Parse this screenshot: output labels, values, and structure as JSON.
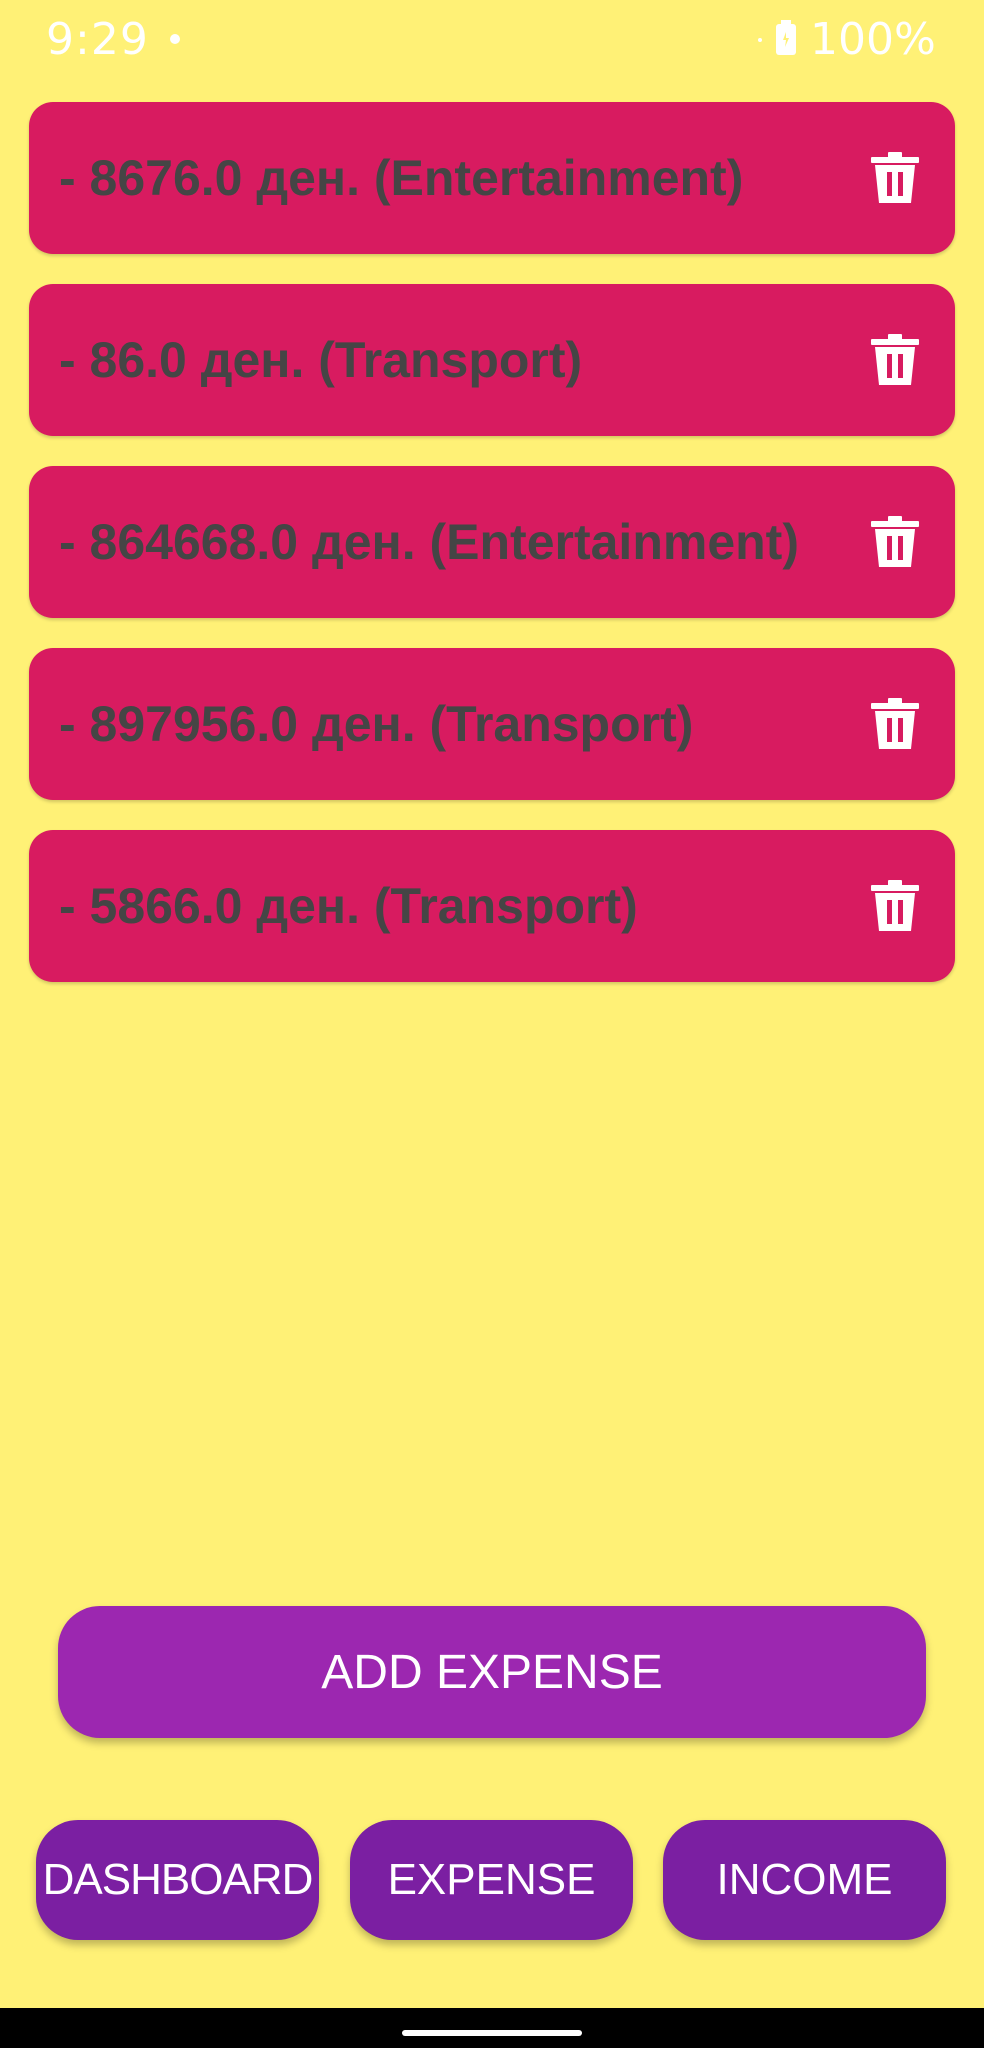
{
  "status_bar": {
    "time": "9:29",
    "battery": "100%"
  },
  "expenses": [
    {
      "label": "- 8676.0 ден. (Entertainment)",
      "amount": "8676.0",
      "category": "Entertainment"
    },
    {
      "label": "- 86.0 ден. (Transport)",
      "amount": "86.0",
      "category": "Transport"
    },
    {
      "label": "- 864668.0 ден. (Entertainment)",
      "amount": "864668.0",
      "category": "Entertainment"
    },
    {
      "label": "- 897956.0 ден. (Transport)",
      "amount": "897956.0",
      "category": "Transport"
    },
    {
      "label": "- 5866.0 ден. (Transport)",
      "amount": "5866.0",
      "category": "Transport"
    }
  ],
  "add_button_label": "ADD EXPENSE",
  "nav": {
    "dashboard": "DASHBOARD",
    "expense": "EXPENSE",
    "income": "INCOME"
  },
  "icons": {
    "delete": "trash-icon"
  },
  "colors": {
    "background": "#FFF176",
    "card": "#D81B60",
    "card_text": "#454545",
    "primary_button": "#9C27B0",
    "nav_button": "#7B1FA2"
  }
}
